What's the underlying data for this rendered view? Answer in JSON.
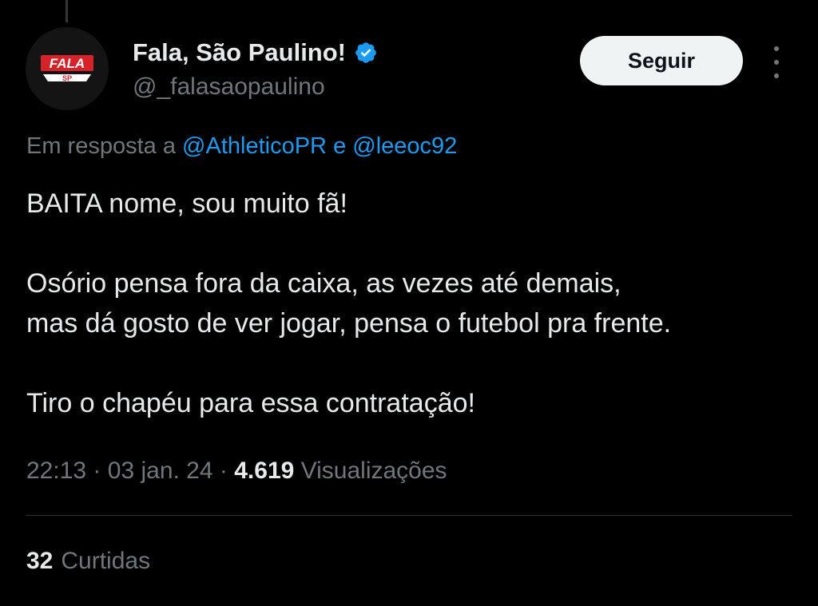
{
  "tweet": {
    "author": {
      "display_name": "Fala, São Paulino!",
      "handle": "@_falasaopaulino",
      "verified": true,
      "avatar_logo_text": "FALA SP",
      "avatar_icon": "fala-sp-logo"
    },
    "follow_button_label": "Seguir",
    "more_icon": "more-vertical-icon",
    "reply_context": {
      "prefix": "Em resposta a",
      "mention_1": "@AthleticoPR",
      "conjunction": "e",
      "mention_2": "@leeoc92"
    },
    "body": {
      "line_1": "BAITA nome, sou muito fã!",
      "line_2": "Osório pensa fora da caixa, as vezes até demais,",
      "line_3": "mas dá gosto de ver jogar, pensa o futebol pra frente.",
      "line_4": "Tiro o chapéu para essa contratação!"
    },
    "meta": {
      "time": "22:13",
      "separator": "·",
      "date": "03 jan. 24",
      "views_count": "4.619",
      "views_label": "Visualizações"
    },
    "likes": {
      "count": "32",
      "label": "Curtidas"
    }
  },
  "colors": {
    "background": "#000000",
    "text_primary": "#e7e9ea",
    "text_secondary": "#71767b",
    "accent": "#1d9bf0",
    "divider": "#2f3336",
    "avatar_red": "#d6232a"
  }
}
